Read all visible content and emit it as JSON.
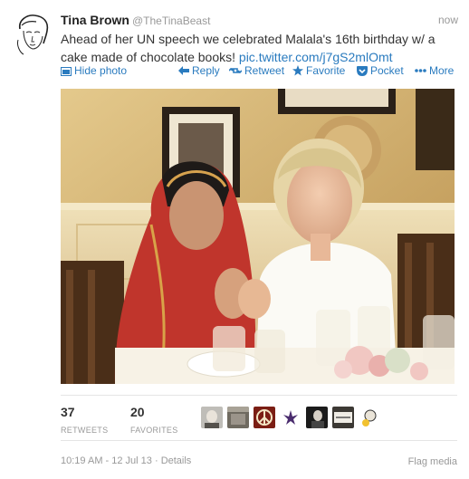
{
  "tweet": {
    "author_name": "Tina Brown",
    "author_handle": "@TheTinaBeast",
    "time": "now",
    "text": "Ahead of her UN speech we celebrated Malala's 16th birthday w/ a cake made of chocolate books!",
    "link": "pic.twitter.com/j7gS2mlOmt"
  },
  "actions": {
    "hide_photo": "Hide photo",
    "reply": "Reply",
    "retweet": "Retweet",
    "favorite": "Favorite",
    "pocket": "Pocket",
    "more": "More"
  },
  "stats": {
    "retweets_count": "37",
    "retweets_label": "RETWEETS",
    "favorites_count": "20",
    "favorites_label": "FAVORITES"
  },
  "footer": {
    "timestamp": "10:19 AM - 12 Jul 13",
    "separator": " · ",
    "details": "Details",
    "flag": "Flag media"
  },
  "icons": [
    "sketch-avatar-icon",
    "photo-icon",
    "reply-icon",
    "retweet-icon",
    "star-icon",
    "pocket-icon",
    "ellipsis-icon"
  ],
  "colors": {
    "link": "#2a7bbf",
    "muted": "#999999",
    "text": "#333333"
  }
}
